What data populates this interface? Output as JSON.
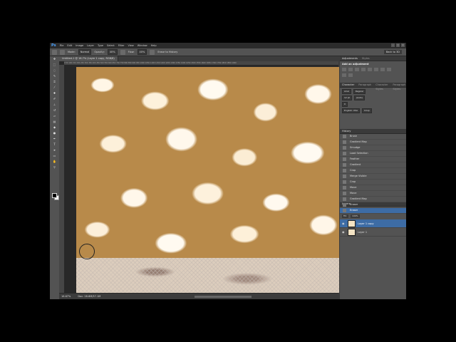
{
  "menubar": {
    "logo": "Ps",
    "items": [
      "File",
      "Edit",
      "Image",
      "Layer",
      "Type",
      "Select",
      "Filter",
      "View",
      "Window",
      "Help"
    ]
  },
  "options": {
    "mode_label": "Mode:",
    "mode_value": "Normal",
    "opacity_label": "Opacity:",
    "opacity_value": "40%",
    "flow_label": "Flow:",
    "flow_value": "40%",
    "erase_history": "Erase to History",
    "workspace": "Back to 3D"
  },
  "document": {
    "tab_title": "Untitled-1 @ 16.7% (Layer 1 copy, RGB/8)",
    "ruler_ticks": "0 50 100 150 200 250 300 350 400 450 500 550 600 650 700 750 800 850 900 950 1000 1050 1100 1150 1200 1250 1300 1350 1400 1450 1500 1550 1600 1650 1700 1750 1800 1850 1900"
  },
  "status": {
    "zoom": "16.67%",
    "doc_size": "Doc: 28.6M/57.1M"
  },
  "panels": {
    "adjustments_tab": "Adjustments",
    "styles_tab": "Styles",
    "adj_title": "Add an adjustment",
    "char_tabs": [
      "Character",
      "Paragraph",
      "Character Styles",
      "Paragraph Styles"
    ],
    "font_family": "Arial",
    "font_style": "Regular",
    "font_size": "12 pt",
    "leading": "(Auto)",
    "tracking": "0",
    "language": "English: USA",
    "aa": "Crisp",
    "history_tab": "History",
    "history_items": [
      "Brush",
      "Gradient Map",
      "Smudge",
      "Load Selection",
      "Feather",
      "Gradient",
      "Crop",
      "Merge Visible",
      "Crop",
      "Move",
      "Move",
      "Gradient Map",
      "Eraser",
      "Eraser"
    ],
    "layers_tab": "Layers",
    "blend_mode": "Normal",
    "opacity_label": "Opacity:",
    "opacity_value": "100%",
    "fill_label": "Fill:",
    "fill_value": "100%",
    "layers": [
      "Layer 1 copy",
      "Layer 1"
    ]
  }
}
